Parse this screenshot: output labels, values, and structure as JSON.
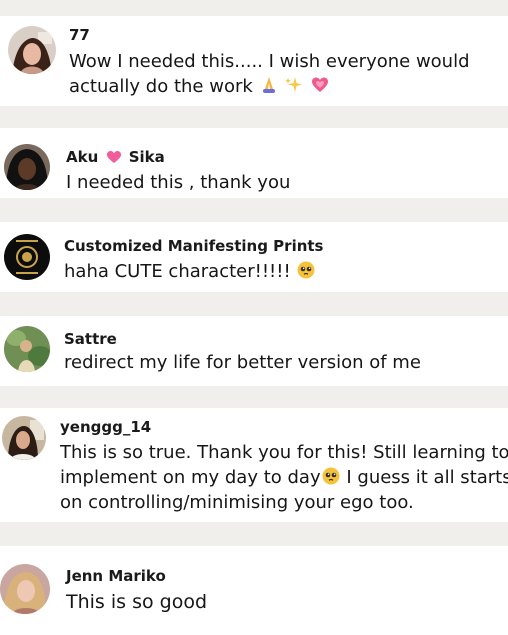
{
  "comments": [
    {
      "username": "77",
      "lines": [
        "Wow I needed this..... I wish everyone would",
        "actually do the work"
      ],
      "trailing_emojis": [
        "folded-hands-icon",
        "sparkles-icon",
        "growing-heart-icon"
      ]
    },
    {
      "username_parts": [
        "Aku",
        "Sika"
      ],
      "username_emoji": "pink-heart-icon",
      "lines": [
        "I needed this , thank you"
      ]
    },
    {
      "username": "Customized Manifesting Prints",
      "lines": [
        "haha CUTE character!!!!!"
      ],
      "trailing_emojis": [
        "pleading-face-icon"
      ]
    },
    {
      "username": "Sattre",
      "lines": [
        "redirect my life for better version of me"
      ]
    },
    {
      "username": "yenggg_14",
      "lines": [
        "This is so true. Thank you for this! Still learning to",
        "implement on my day to day",
        "I guess it all starts",
        "on controlling/minimising your ego too."
      ],
      "inline_emoji": "pleading-face-icon"
    },
    {
      "username": "Jenn Mariko",
      "lines": [
        "This is so good"
      ]
    }
  ],
  "colors": {
    "background": "#f0efeb",
    "card": "#ffffff",
    "text": "#161616"
  }
}
